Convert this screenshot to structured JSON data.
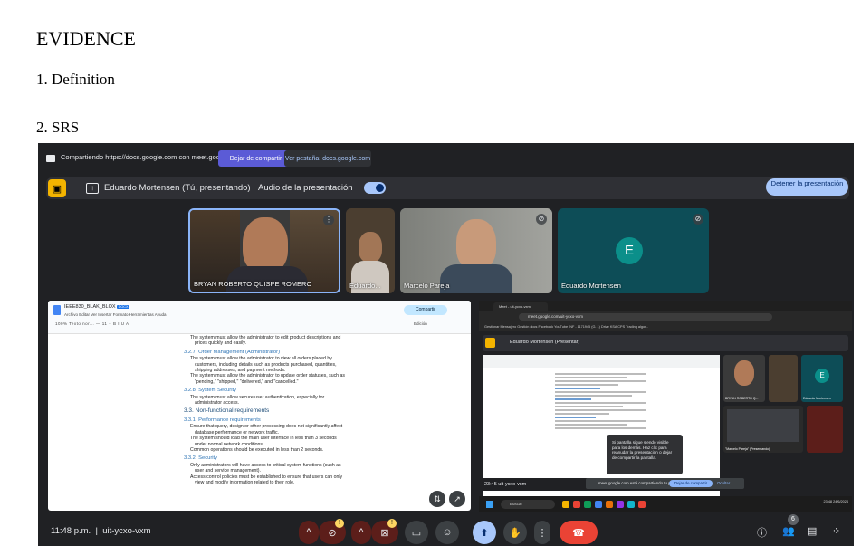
{
  "document": {
    "heading": "EVIDENCE",
    "item1": "1. Definition",
    "item2": "2. SRS"
  },
  "share_bar": {
    "text": "Compartiendo https://docs.google.com con meet.google.com",
    "stop_label": "Dejar de compartir",
    "view_label": "Ver pestaña: docs.google.com"
  },
  "presenter_bar": {
    "presenter": "Eduardo Mortensen (Tú, presentando)",
    "audio_label": "Audio de la presentación",
    "stop_label": "Detener la presentación"
  },
  "participants": [
    {
      "name": "BRYAN ROBERTO QUISPE ROMERO"
    },
    {
      "name": "Eduardo..."
    },
    {
      "name": "Marcelo Pareja"
    },
    {
      "name": "Eduardo Mortensen",
      "initial": "E"
    }
  ],
  "docs": {
    "title": "IEEE830_BLAK_BLOX",
    "badge": "DOCX",
    "menu": "Archivo  Editar  Ver  Insertar  Formato  Herramientas  Ayuda",
    "toolbar": "100%   Texto nor...   —  11  +   B  I  U  A",
    "share_label": "Compartir",
    "mode_label": "Edición",
    "lines": [
      "The system must allow the administrator to edit product descriptions and prices quickly and easily.",
      "3.2.7. Order Management (Administrator)",
      "The system must allow the administrator to view all orders placed by customers, including details such as products purchased, quantities, shipping addresses, and payment methods.",
      "The system must allow the administrator to update order statuses, such as \"pending,\" \"shipped,\" \"delivered,\" and \"cancelled.\"",
      "3.2.8. System Security",
      "The system must allow secure user authentication, especially for administrator access.",
      "3.3.  Non-functional requirements",
      "3.3.1. Performance requirements",
      "Ensure that query, design or other processing does not significantly affect database performance or network traffic.",
      "The system should load the main user interface in less than 3 seconds under normal network conditions.",
      "Common operations should be executed in less than 2 seconds.",
      "3.3.2. Security",
      "Only administrators will have access to critical system functions (such as user and service management).",
      "Access control policies must be established to ensure that users can only view and modify information related to their role."
    ]
  },
  "inner_screen": {
    "tab_title": "Meet - uit-ycxo-vxm",
    "url": "meet.google.com/uit-ycxo-vxm",
    "bookmarks": "Gestionar   Mensajero   Gestión docs   Facebook   YouTube   INF - 1171945 (G. 1)   Drive   KSA CPS   Trading algor...",
    "presenter": "Eduardo Mortensen (Presentar)",
    "popup": "Si pantalla sigue siendo visible para los demás. Haz clic para reanudar la presentación o dejar de compartir la pantalla.",
    "time": "23:45  uit-ycxo-vxm",
    "toast": "meet.google.com está compartiendo tu pantalla.",
    "toast_btn": "Dejar de compartir",
    "toast_hide": "Ocultar",
    "search": "Buscar",
    "clock": "23:48\n24/6/2024",
    "tiles": [
      "BRYAN ROBERTO Q...",
      "",
      "Eduardo Mortensen"
    ],
    "tile_initial": "E",
    "tile_bottom": "\"Marcelo Pareja\" (Presentando)"
  },
  "controls": {
    "time": "11:48 p.m.",
    "code": "uit-ycxo-vxm",
    "participants_count": "6"
  },
  "colors": {
    "meet_bg": "#202124",
    "accent": "#a8c7fa",
    "share_btn": "#5b5bd6",
    "hangup": "#ea4335",
    "warn": "#fdd663"
  }
}
